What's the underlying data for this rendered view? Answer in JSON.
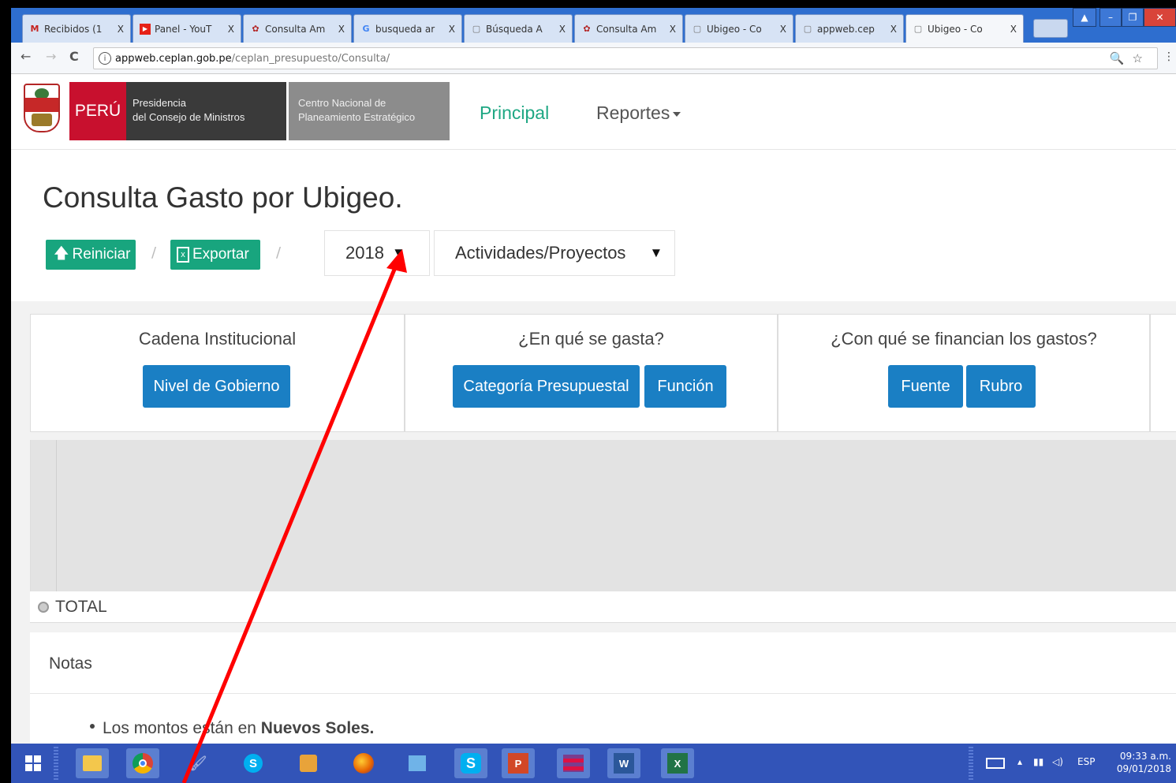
{
  "browser": {
    "tabs": [
      {
        "title": "Recibidos (1",
        "icon": "gmail-icon",
        "color": "#c5221f",
        "glyph": "M"
      },
      {
        "title": "Panel - YouT",
        "icon": "youtube-icon",
        "color": "#e62117",
        "glyph": "▶"
      },
      {
        "title": "Consulta Am",
        "icon": "peru-shield-icon",
        "color": "#b32626",
        "glyph": "✿"
      },
      {
        "title": "busqueda ar",
        "icon": "google-icon",
        "color": "#4285f4",
        "glyph": "G"
      },
      {
        "title": "Búsqueda A",
        "icon": "page-icon",
        "color": "#777",
        "glyph": "▢"
      },
      {
        "title": "Consulta Am",
        "icon": "peru-shield-icon",
        "color": "#b32626",
        "glyph": "✿"
      },
      {
        "title": "Ubigeo - Co",
        "icon": "page-icon",
        "color": "#777",
        "glyph": "▢"
      },
      {
        "title": "appweb.cep",
        "icon": "page-icon",
        "color": "#777",
        "glyph": "▢"
      },
      {
        "title": "Ubigeo - Co",
        "icon": "page-icon",
        "color": "#777",
        "glyph": "▢"
      }
    ],
    "close_glyph": "X",
    "url_host": "appweb.ceplan.gob.pe",
    "url_path": "/ceplan_presupuesto/Consulta/",
    "url_right_icons": "🔍☆",
    "menu": "⋮"
  },
  "header": {
    "peru_label": "PERÚ",
    "pcm_line1": "Presidencia",
    "pcm_line2": "del Consejo de Ministros",
    "ceplan_line1": "Centro Nacional de",
    "ceplan_line2": "Planeamiento Estratégico",
    "nav_principal": "Principal",
    "nav_reportes": "Reportes"
  },
  "main": {
    "title": "Consulta Gasto por Ubigeo.",
    "reiniciar": "Reiniciar",
    "exportar": "Exportar",
    "separator": "/",
    "year": "2018",
    "scope": "Actividades/Proyectos",
    "dropdown_glyph": "▼"
  },
  "panels": [
    {
      "heading": "Cadena Institucional",
      "buttons": [
        "Nivel de Gobierno"
      ]
    },
    {
      "heading": "¿En qué se gasta?",
      "buttons": [
        "Categoría Presupuestal",
        "Función"
      ]
    },
    {
      "heading": "¿Con qué se financian los gastos?",
      "buttons": [
        "Fuente",
        "Rubro"
      ]
    }
  ],
  "table": {
    "total_label": "TOTAL"
  },
  "notes": {
    "heading": "Notas",
    "item_prefix": "Los montos están en ",
    "item_bold": "Nuevos Soles."
  },
  "taskbar": {
    "apps": [
      "windows-start-icon",
      "file-explorer-icon",
      "chrome-icon",
      "paint-icon",
      "skype-icon",
      "puzzle-app-icon",
      "firefox-icon",
      "control-panel-icon",
      "skype-business-icon",
      "powerpoint-icon",
      "winrar-icon",
      "word-icon",
      "excel-icon"
    ],
    "lang": "ESP",
    "time": "09:33 a.m.",
    "date": "09/01/2018"
  },
  "annotation": {
    "arrow_color": "#ff0000"
  }
}
